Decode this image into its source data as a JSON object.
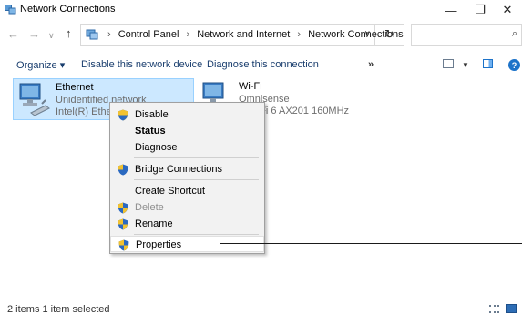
{
  "window": {
    "title": "Network Connections",
    "minimize_glyph": "—",
    "maximize_glyph": "❐",
    "close_glyph": "✕"
  },
  "address": {
    "crumbs": [
      "Control Panel",
      "Network and Internet",
      "Network Connections"
    ],
    "separator": "›",
    "search_placeholder": ""
  },
  "toolbar": {
    "organize_label": "Organize ▾",
    "disable_label": "Disable this network device",
    "diagnose_label": "Diagnose this connection",
    "more_label": "»",
    "help_label": "?"
  },
  "items": [
    {
      "name": "Ethernet",
      "status": "Unidentified network",
      "device": "Intel(R) Ethern",
      "selected": true
    },
    {
      "name": "Wi-Fi",
      "status": "Omnisense",
      "device": ") Wi-Fi 6 AX201 160MHz",
      "selected": false
    }
  ],
  "context_menu": {
    "items": [
      {
        "label": "Disable",
        "icon": "shield-icon",
        "bold": false,
        "disabled": false
      },
      {
        "label": "Status",
        "icon": "",
        "bold": true,
        "disabled": false
      },
      {
        "label": "Diagnose",
        "icon": "",
        "bold": false,
        "disabled": false
      },
      {
        "label": "Bridge Connections",
        "icon": "shield-icon",
        "bold": false,
        "disabled": false
      },
      {
        "label": "Create Shortcut",
        "icon": "",
        "bold": false,
        "disabled": false
      },
      {
        "label": "Delete",
        "icon": "shield-icon",
        "bold": false,
        "disabled": true
      },
      {
        "label": "Rename",
        "icon": "shield-icon",
        "bold": false,
        "disabled": false
      },
      {
        "label": "Properties",
        "icon": "shield-icon",
        "bold": false,
        "disabled": false,
        "highlighted": true
      }
    ]
  },
  "status": {
    "count_text": "2 items   1 item selected"
  },
  "colors": {
    "selection_bg": "#cce8ff",
    "selection_border": "#99d1ff",
    "link_text": "#1a3e6e",
    "accent": "#1d73c9"
  }
}
